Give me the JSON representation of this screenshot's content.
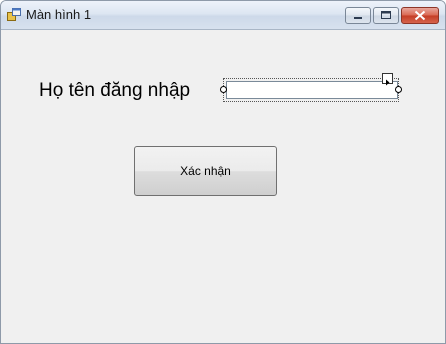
{
  "window": {
    "title": "Màn hình 1",
    "controls": {
      "minimize_icon": "minimize-icon",
      "maximize_icon": "maximize-icon",
      "close_icon": "close-icon"
    }
  },
  "form": {
    "login_label": "Họ tên đăng nhập",
    "login_value": "",
    "login_placeholder": "",
    "confirm_label": "Xác nhận"
  },
  "colors": {
    "form_background": "#f0f0f0",
    "close_button": "#c43c24",
    "titlebar": "#dde6f2"
  }
}
